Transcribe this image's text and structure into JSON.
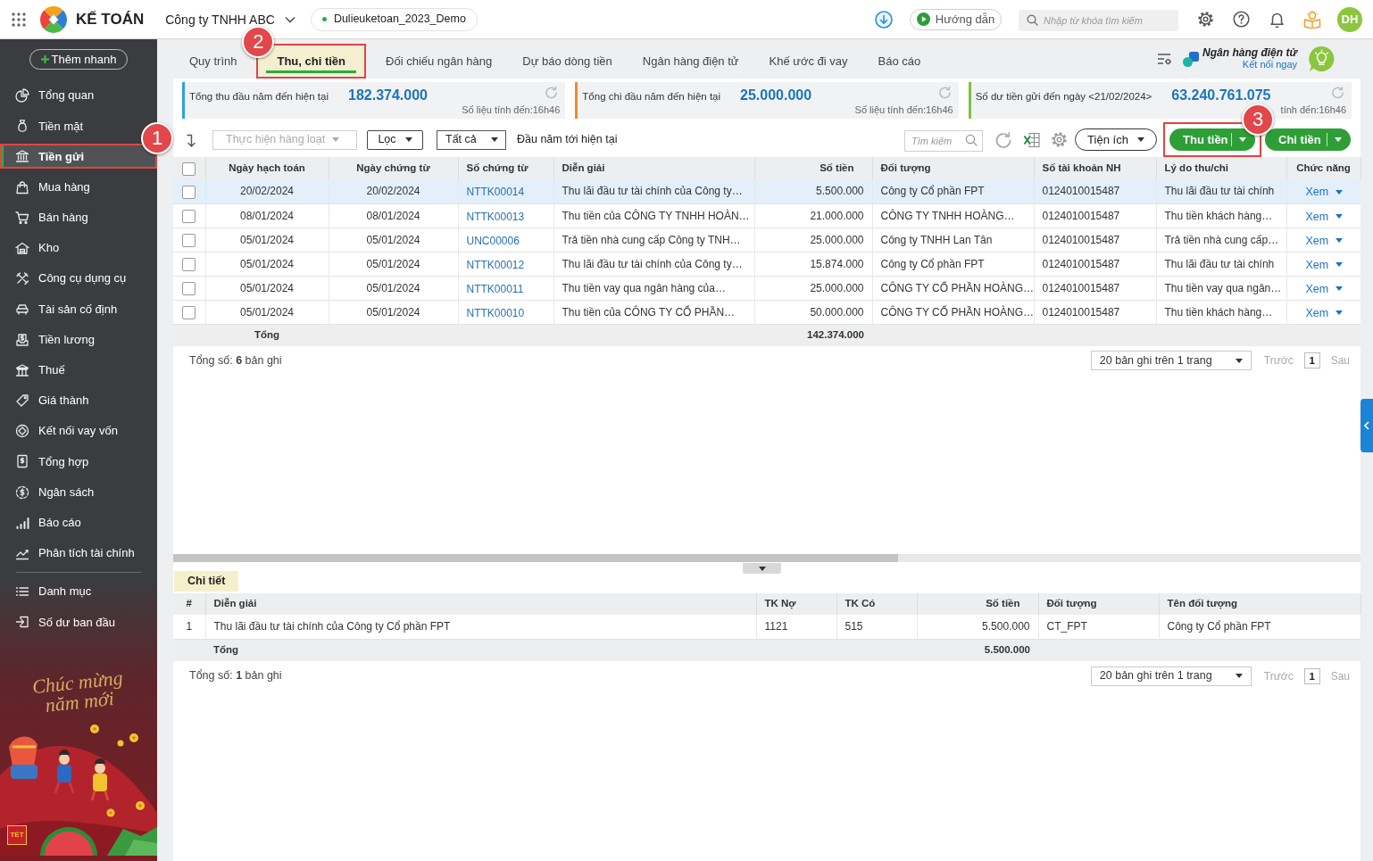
{
  "top_bar": {
    "app_name": "KẾ TOÁN",
    "company": "Công ty TNHH ABC",
    "database": "Dulieuketoan_2023_Demo",
    "guide_button": "Hướng dẫn",
    "search": {
      "placeholder": "Nhập từ khóa tìm kiếm"
    },
    "avatar": "DH"
  },
  "sidebar": {
    "quick_add": "Thêm nhanh",
    "items": [
      {
        "label": "Tổng quan",
        "selected": false
      },
      {
        "label": "Tiền mặt",
        "selected": false
      },
      {
        "label": "Tiền gửi",
        "selected": true,
        "callout": "1"
      },
      {
        "label": "Mua hàng",
        "selected": false
      },
      {
        "label": "Bán hàng",
        "selected": false
      },
      {
        "label": "Kho",
        "selected": false
      },
      {
        "label": "Công cụ dụng cụ",
        "selected": false
      },
      {
        "label": "Tài sản cố định",
        "selected": false
      },
      {
        "label": "Tiền lương",
        "selected": false
      },
      {
        "label": "Thuế",
        "selected": false
      },
      {
        "label": "Giá thành",
        "selected": false
      },
      {
        "label": "Kết nối vay vốn",
        "selected": false
      },
      {
        "label": "Tổng hợp",
        "selected": false
      },
      {
        "label": "Ngân sách",
        "selected": false
      },
      {
        "label": "Báo cáo",
        "selected": false
      },
      {
        "label": "Phân tích tài chính",
        "selected": false
      }
    ],
    "footer_items": [
      {
        "label": "Danh mục",
        "selected": false
      },
      {
        "label": "Số dư ban đầu",
        "selected": false
      }
    ],
    "banner": {
      "greeting": "Chúc mừng năm mới",
      "tag": "TẾT"
    }
  },
  "tabs": [
    {
      "label": "Quy trình",
      "selected": false
    },
    {
      "label": "Thu, chi tiền",
      "selected": true,
      "callout": "2"
    },
    {
      "label": "Đối chiếu ngân hàng",
      "selected": false
    },
    {
      "label": "Dự báo dòng tiền",
      "selected": false
    },
    {
      "label": "Ngân hàng điện tử",
      "selected": false
    },
    {
      "label": "Khế ước đi vay",
      "selected": false
    },
    {
      "label": "Báo cáo",
      "selected": false
    }
  ],
  "e_banking": {
    "title": "Ngân hàng điện tử",
    "link": "Kết nối ngay"
  },
  "summary_cards": [
    {
      "label": "Tổng thu đầu năm đến hiện tại",
      "value": "182.374.000",
      "note": "Số liệu tính đến:16h46",
      "color": "#29a3dd"
    },
    {
      "label": "Tổng chi đầu năm đến hiện tại",
      "value": "25.000.000",
      "note": "Số liệu tính đến:16h46",
      "color": "#f0892a"
    },
    {
      "label": "Số dư tiền gửi đến ngày <21/02/2024>",
      "value": "63.240.761.075",
      "note": "tính đến:16h46",
      "color": "#7cc242"
    }
  ],
  "toolbar": {
    "bulk_action": {
      "label": "Thực hiện hàng loạt",
      "disabled": true
    },
    "filter": "Lọc",
    "scope": "Tất cả",
    "period": "Đầu năm tới hiện tại",
    "search": {
      "placeholder": "Tìm kiếm"
    },
    "utilities": "Tiện ích",
    "actions": [
      {
        "label": "Thu tiền",
        "callout": "3"
      },
      {
        "label": "Chi tiền"
      }
    ]
  },
  "table": {
    "select_all": {
      "checked": false
    },
    "columns": [
      "Ngày hạch toán",
      "Ngày chứng từ",
      "Số chứng từ",
      "Diễn giải",
      "Số tiền",
      "Đối tượng",
      "Số tài khoản NH",
      "Lý do thu/chi",
      "Chức năng"
    ],
    "rows": [
      {
        "selected": true,
        "checked": false,
        "cells": [
          "20/02/2024",
          "20/02/2024",
          "NTTK00014",
          "Thu lãi đầu tư tài chính của Công ty…",
          "5.500.000",
          "Công ty Cổ phần FPT",
          "0124010015487",
          "Thu lãi đầu tư tài chính",
          "Xem"
        ]
      },
      {
        "selected": false,
        "checked": false,
        "cells": [
          "08/01/2024",
          "08/01/2024",
          "NTTK00013",
          "Thu tiền của CÔNG TY TNHH HOÀN…",
          "21.000.000",
          "CÔNG TY TNHH HOÀNG…",
          "0124010015487",
          "Thu tiền khách hàng…",
          "Xem"
        ]
      },
      {
        "selected": false,
        "checked": false,
        "cells": [
          "05/01/2024",
          "05/01/2024",
          "UNC00006",
          "Trả tiền nhà cung cấp Công ty TNH…",
          "25.000.000",
          "Công ty TNHH Lan Tân",
          "0124010015487",
          "Trả tiền nhà cung cấp…",
          "Xem"
        ]
      },
      {
        "selected": false,
        "checked": false,
        "cells": [
          "05/01/2024",
          "05/01/2024",
          "NTTK00012",
          "Thu lãi đầu tư tài chính của Công ty…",
          "15.874.000",
          "Công ty Cổ phần FPT",
          "0124010015487",
          "Thu lãi đầu tư tài chính",
          "Xem"
        ]
      },
      {
        "selected": false,
        "checked": false,
        "cells": [
          "05/01/2024",
          "05/01/2024",
          "NTTK00011",
          "Thu tiền vay qua ngân hàng của…",
          "25.000.000",
          "CÔNG TY CỔ PHẦN HOÀNG…",
          "0124010015487",
          "Thu tiền vay qua ngân…",
          "Xem"
        ]
      },
      {
        "selected": false,
        "checked": false,
        "cells": [
          "05/01/2024",
          "05/01/2024",
          "NTTK00010",
          "Thu tiền của CÔNG TY CỔ PHẦN…",
          "50.000.000",
          "CÔNG TY CỔ PHẦN HOÀNG…",
          "0124010015487",
          "Thu tiền khách hàng…",
          "Xem"
        ]
      }
    ],
    "total": {
      "label": "Tổng",
      "amount": "142.374.000"
    },
    "record_count": "Tổng số: **6** bản ghi",
    "pagination": {
      "page_size": "20 bản ghi trên 1 trang",
      "previous": {
        "label": "Trước",
        "disabled": true
      },
      "pages": [
        {
          "label": "1",
          "selected": true
        }
      ],
      "next": {
        "label": "Sau",
        "disabled": true
      }
    }
  },
  "detail": {
    "tabs": [
      {
        "label": "Chi tiết",
        "selected": true
      }
    ],
    "columns": [
      "#",
      "Diễn giải",
      "TK Nợ",
      "TK Có",
      "Số tiền",
      "Đối tượng",
      "Tên đối tượng"
    ],
    "rows": [
      {
        "cells": [
          "1",
          "Thu lãi đầu tư tài chính của Công ty Cổ phần FPT",
          "1121",
          "515",
          "5.500.000",
          "CT_FPT",
          "Công ty Cổ phần FPT"
        ]
      }
    ],
    "total": {
      "label": "Tổng",
      "amount": "5.500.000"
    },
    "record_count": "Tổng số: **1** bản ghi",
    "pagination": {
      "page_size": "20 bản ghi trên 1 trang",
      "previous": {
        "label": "Trước",
        "disabled": true
      },
      "pages": [
        {
          "label": "1",
          "selected": true
        }
      ],
      "next": {
        "label": "Sau",
        "disabled": true
      }
    }
  }
}
